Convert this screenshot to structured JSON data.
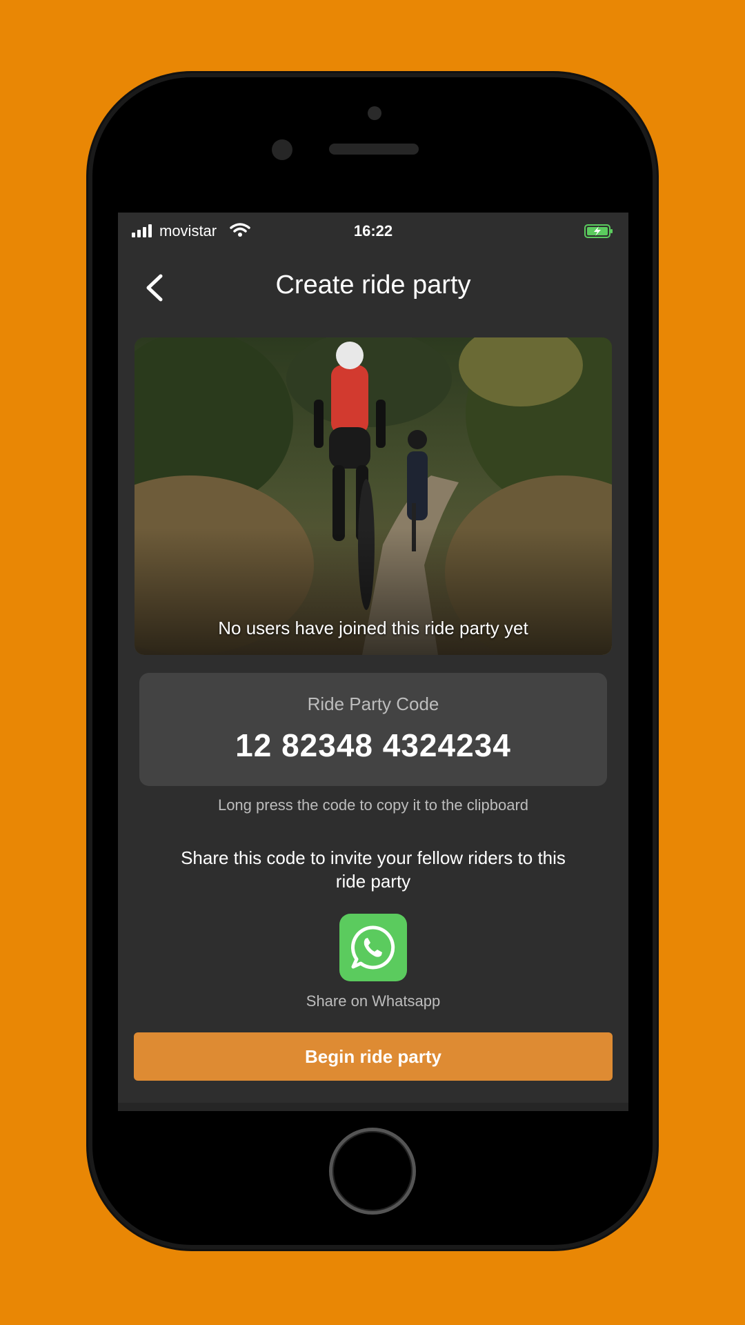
{
  "status_bar": {
    "carrier": "movistar",
    "time": "16:22",
    "battery_color": "#5BCB5E"
  },
  "nav": {
    "title": "Create ride party",
    "back_icon": "chevron-left-icon"
  },
  "hero": {
    "caption": "No users have joined this ride party yet"
  },
  "code_card": {
    "label": "Ride Party Code",
    "code": "12 82348 4324234"
  },
  "copy_hint": "Long press the code to copy it to the clipboard",
  "share_text": "Share this code to invite your fellow riders to this ride party",
  "whatsapp": {
    "label": "Share on Whatsapp",
    "icon": "whatsapp-icon",
    "color": "#5BCB5E"
  },
  "begin_button": {
    "label": "Begin ride party",
    "color": "#DE8B33"
  },
  "colors": {
    "page_background": "#E98705",
    "screen_background": "#2E2E2E",
    "card_background": "#434343"
  }
}
